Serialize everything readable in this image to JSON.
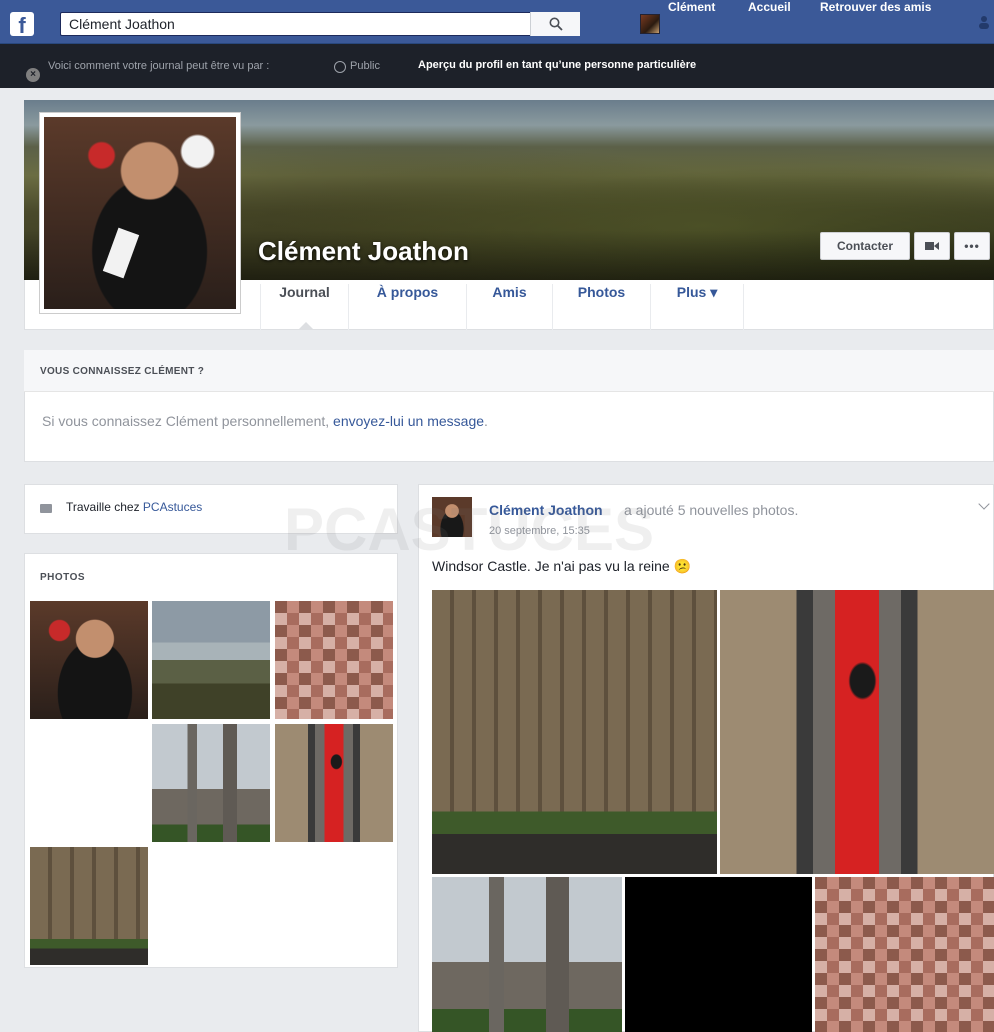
{
  "topbar": {
    "logo": "f",
    "search_value": "Clément Joathon",
    "user_name": "Clément",
    "home": "Accueil",
    "find_friends": "Retrouver des amis"
  },
  "privacy_bar": {
    "text": "Voici comment votre journal peut être vu par :",
    "audience": "Public",
    "preview": "Aperçu du profil en tant qu’une personne particulière"
  },
  "profile": {
    "name": "Clément Joathon",
    "contact_button": "Contacter",
    "tabs": [
      "Journal",
      "À propos",
      "Amis",
      "Photos",
      "Plus ▾"
    ]
  },
  "know_box": {
    "title": "VOUS CONNAISSEZ CLÉMENT ?",
    "message_prefix": "Si vous connaissez Clément personnellement, ",
    "message_link": "envoyez-lui un message",
    "message_suffix": "."
  },
  "intro": {
    "work_prefix": "Travaille chez ",
    "work_company": "PCAstuces"
  },
  "photos": {
    "title": "PHOTOS"
  },
  "post": {
    "author": "Clément Joathon",
    "action": "a ajouté 5 nouvelles photos.",
    "time": "20 septembre, 15:35",
    "text": "Windsor Castle. Je n'ai pas vu la reine 😕"
  },
  "watermark": "PCASTUCES",
  "colors": {
    "brand": "#3b5998",
    "link": "#365899",
    "privacy_bar": "#1d2129"
  }
}
